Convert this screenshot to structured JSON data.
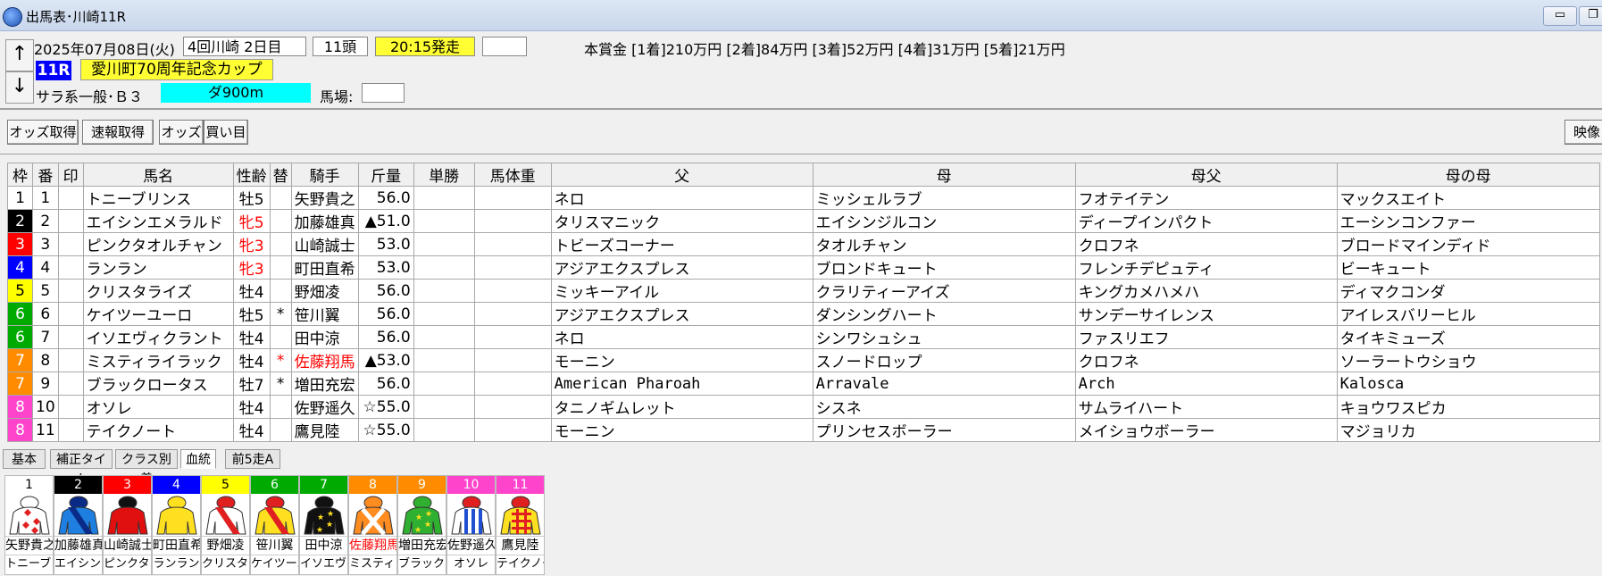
{
  "window": {
    "title": "出馬表･川崎11R",
    "minimize": "▭",
    "restore": "❐"
  },
  "header": {
    "up": "↑",
    "down": "↓",
    "date": "2025年07月08日(火)",
    "meeting": "4回川崎 2日目",
    "heads": "11頭",
    "post_time": "20:15発走",
    "post_extra": "",
    "prize": "本賞金 [1着]210万円 [2着]84万円 [3着]52万円 [4着]31万円 [5着]21万円",
    "race_num": "11R",
    "race_name": "愛川町70周年記念カップ",
    "race_class": "サラ系一般･Ｂ３",
    "course": "ダ900m",
    "baba_label": "馬場:",
    "baba_value": ""
  },
  "toolbar": {
    "odds_fetch": "オッズ取得",
    "flash_fetch": "速報取得",
    "odds": "オッズ",
    "bets": "買い目",
    "video": "映像"
  },
  "table": {
    "headers": [
      "枠",
      "番",
      "印",
      "馬名",
      "性齢",
      "替",
      "騎手",
      "斤量",
      "単勝",
      "馬体重",
      "父",
      "母",
      "母父",
      "母の母"
    ],
    "rows": [
      {
        "waku": "1",
        "num": "1",
        "mark": "",
        "name": "トニーブリンス",
        "sex": "牡5",
        "sex_red": false,
        "kae": "",
        "jockey": "矢野貴之",
        "jockey_red": false,
        "weight": "56.0",
        "odds": "",
        "bw": "",
        "sire": "ネロ",
        "dam": "ミッシェルラブ",
        "bms": "フオテイテン",
        "dd": "マックスエイト"
      },
      {
        "waku": "2",
        "num": "2",
        "mark": "",
        "name": "エイシンエメラルド",
        "sex": "牝5",
        "sex_red": true,
        "kae": "",
        "jockey": "加藤雄真",
        "jockey_red": false,
        "weight": "▲51.0",
        "odds": "",
        "bw": "",
        "sire": "タリスマニック",
        "dam": "エイシンジルコン",
        "bms": "ディープインパクト",
        "dd": "エーシンコンファー"
      },
      {
        "waku": "3",
        "num": "3",
        "mark": "",
        "name": "ピンクタオルチャン",
        "sex": "牝3",
        "sex_red": true,
        "kae": "",
        "jockey": "山崎誠士",
        "jockey_red": false,
        "weight": "53.0",
        "odds": "",
        "bw": "",
        "sire": "トビーズコーナー",
        "dam": "タオルチャン",
        "bms": "クロフネ",
        "dd": "ブロードマインディド"
      },
      {
        "waku": "4",
        "num": "4",
        "mark": "",
        "name": "ランラン",
        "sex": "牝3",
        "sex_red": true,
        "kae": "",
        "jockey": "町田直希",
        "jockey_red": false,
        "weight": "53.0",
        "odds": "",
        "bw": "",
        "sire": "アジアエクスプレス",
        "dam": "ブロンドキュート",
        "bms": "フレンチデピュティ",
        "dd": "ビーキュート"
      },
      {
        "waku": "5",
        "num": "5",
        "mark": "",
        "name": "クリスタライズ",
        "sex": "牡4",
        "sex_red": false,
        "kae": "",
        "jockey": "野畑凌",
        "jockey_red": false,
        "weight": "56.0",
        "odds": "",
        "bw": "",
        "sire": "ミッキーアイル",
        "dam": "クラリティーアイズ",
        "bms": "キングカメハメハ",
        "dd": "ディマクコンダ"
      },
      {
        "waku": "6",
        "num": "6",
        "mark": "",
        "name": "ケイツーユーロ",
        "sex": "牡5",
        "sex_red": false,
        "kae": "*",
        "jockey": "笹川翼",
        "jockey_red": false,
        "weight": "56.0",
        "odds": "",
        "bw": "",
        "sire": "アジアエクスプレス",
        "dam": "ダンシングハート",
        "bms": "サンデーサイレンス",
        "dd": "アイレスバリーヒル"
      },
      {
        "waku": "6",
        "num": "7",
        "mark": "",
        "name": "イソエヴィクラント",
        "sex": "牡4",
        "sex_red": false,
        "kae": "",
        "jockey": "田中涼",
        "jockey_red": false,
        "weight": "56.0",
        "odds": "",
        "bw": "",
        "sire": "ネロ",
        "dam": "シンワシュシュ",
        "bms": "ファスリエフ",
        "dd": "タイキミューズ"
      },
      {
        "waku": "7",
        "num": "8",
        "mark": "",
        "name": "ミスティライラック",
        "sex": "牡4",
        "sex_red": false,
        "kae": "*",
        "jockey": "佐藤翔馬",
        "jockey_red": true,
        "weight": "▲53.0",
        "odds": "",
        "bw": "",
        "sire": "モーニン",
        "dam": "スノードロップ",
        "bms": "クロフネ",
        "dd": "ソーラートウショウ"
      },
      {
        "waku": "7",
        "num": "9",
        "mark": "",
        "name": "ブラックロータス",
        "sex": "牡7",
        "sex_red": false,
        "kae": "*",
        "jockey": "増田充宏",
        "jockey_red": false,
        "weight": "56.0",
        "odds": "",
        "bw": "",
        "sire": "American Pharoah",
        "dam": "Arravale",
        "bms": "Arch",
        "dd": "Kalosca"
      },
      {
        "waku": "8",
        "num": "10",
        "mark": "",
        "name": "オソレ",
        "sex": "牡4",
        "sex_red": false,
        "kae": "",
        "jockey": "佐野遥久",
        "jockey_red": false,
        "weight": "☆55.0",
        "odds": "",
        "bw": "",
        "sire": "タニノギムレット",
        "dam": "シスネ",
        "bms": "サムライハート",
        "dd": "キョウワスピカ"
      },
      {
        "waku": "8",
        "num": "11",
        "mark": "",
        "name": "テイクノート",
        "sex": "牡4",
        "sex_red": false,
        "kae": "",
        "jockey": "鷹見陸",
        "jockey_red": false,
        "weight": "☆55.0",
        "odds": "",
        "bw": "",
        "sire": "モーニン",
        "dam": "プリンセスボーラー",
        "bms": "メイショウボーラー",
        "dd": "マジョリカ"
      }
    ]
  },
  "tabs": [
    "基本",
    "補正タイム",
    "クラス別着",
    "血統",
    "前5走A"
  ],
  "active_tab": "血統",
  "silks": [
    {
      "num": "1",
      "jockey": "矢野貴之",
      "horse": "トニーブリ",
      "jockey_red": false
    },
    {
      "num": "2",
      "jockey": "加藤雄真",
      "horse": "エイシンエ",
      "jockey_red": false
    },
    {
      "num": "3",
      "jockey": "山崎誠士",
      "horse": "ピンクタオ",
      "jockey_red": false
    },
    {
      "num": "4",
      "jockey": "町田直希",
      "horse": "ランラン",
      "jockey_red": false
    },
    {
      "num": "5",
      "jockey": "野畑凌",
      "horse": "クリスタラ",
      "jockey_red": false
    },
    {
      "num": "6",
      "jockey": "笹川翼",
      "horse": "ケイツーユ",
      "jockey_red": false
    },
    {
      "num": "7",
      "jockey": "田中涼",
      "horse": "イソエヴィ",
      "jockey_red": false
    },
    {
      "num": "8",
      "jockey": "佐藤翔馬",
      "horse": "ミスティラ",
      "jockey_red": true
    },
    {
      "num": "9",
      "jockey": "増田充宏",
      "horse": "ブラックロ",
      "jockey_red": false
    },
    {
      "num": "10",
      "jockey": "佐野遥久",
      "horse": "オソレ",
      "jockey_red": false
    },
    {
      "num": "11",
      "jockey": "鷹見陸",
      "horse": "テイクノー",
      "jockey_red": false
    }
  ],
  "colors": {
    "waku": {
      "1": "#ffffff",
      "2": "#000000",
      "3": "#ff0000",
      "4": "#0000ff",
      "5": "#ffff00",
      "6": "#00aa00",
      "7": "#ff8c00",
      "8": "#ff44cc"
    },
    "waku_text": {
      "1": "#000000",
      "2": "#ffffff",
      "3": "#ffffff",
      "4": "#ffffff",
      "5": "#000000",
      "6": "#ffffff",
      "7": "#ffffff",
      "8": "#ffffff"
    },
    "accent_race": "#0000ff",
    "post_time_bg": "#ffff33",
    "course_bg": "#00ffff"
  }
}
